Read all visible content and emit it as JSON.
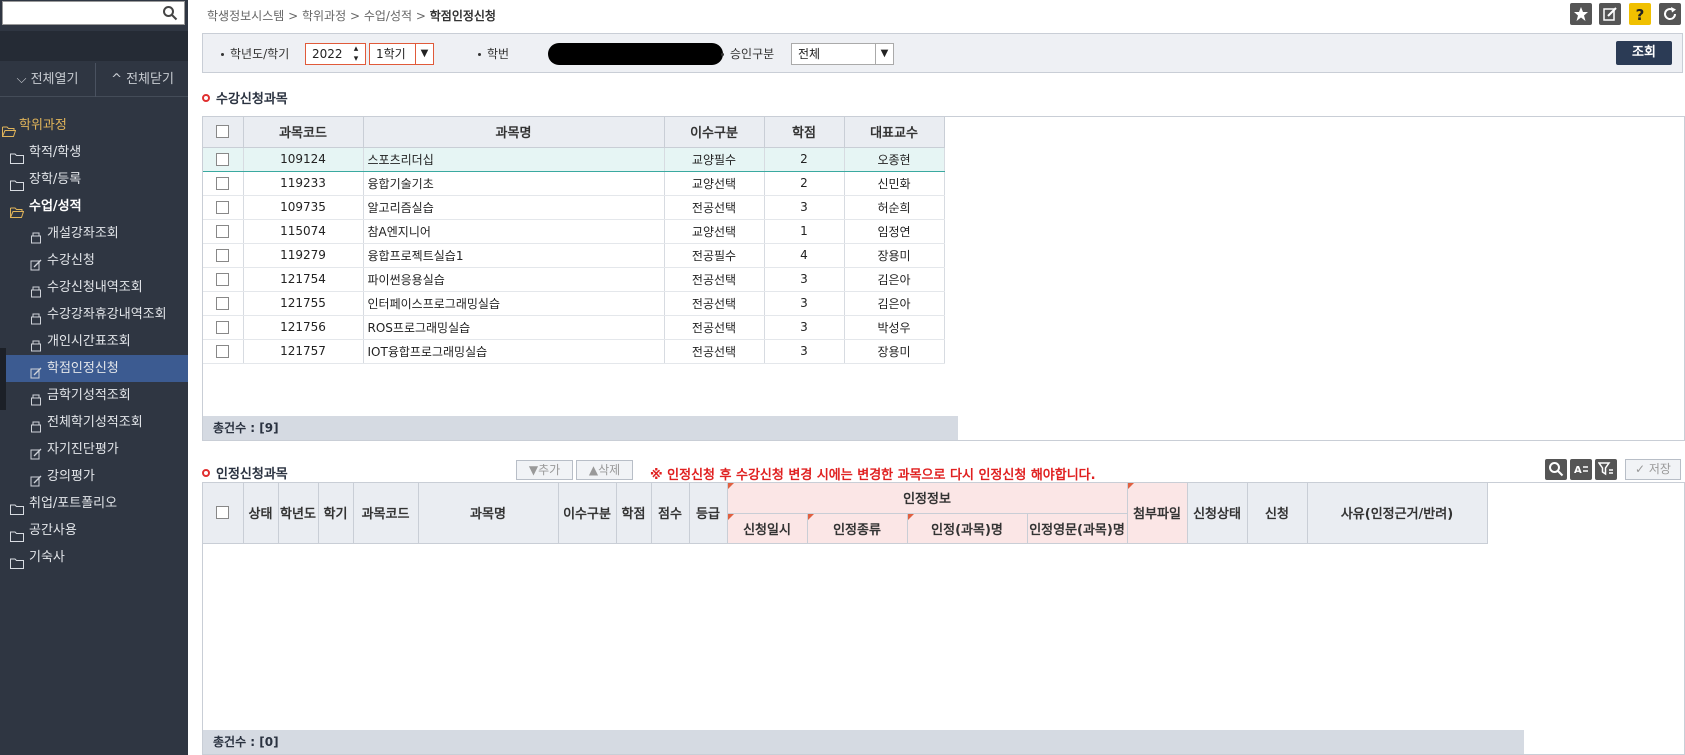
{
  "sidebar": {
    "search_placeholder": "",
    "expand_all": "전체열기",
    "collapse_all": "전체닫기",
    "tree": [
      {
        "label": "학위과정",
        "level": 0,
        "state": "open"
      },
      {
        "label": "학적/학생",
        "level": 1
      },
      {
        "label": "장학/등록",
        "level": 1
      },
      {
        "label": "수업/성적",
        "level": 1,
        "state": "open"
      },
      {
        "label": "개설강좌조회",
        "level": 2
      },
      {
        "label": "수강신청",
        "level": 2
      },
      {
        "label": "수강신청내역조회",
        "level": 2
      },
      {
        "label": "수강강좌휴강내역조회",
        "level": 2
      },
      {
        "label": "개인시간표조회",
        "level": 2
      },
      {
        "label": "학점인정신청",
        "level": 2,
        "state": "active"
      },
      {
        "label": "금학기성적조회",
        "level": 2
      },
      {
        "label": "전체학기성적조회",
        "level": 2
      },
      {
        "label": "자기진단평가",
        "level": 2
      },
      {
        "label": "강의평가",
        "level": 2
      },
      {
        "label": "취업/포트폴리오",
        "level": 1
      },
      {
        "label": "공간사용",
        "level": 1
      },
      {
        "label": "기숙사",
        "level": 1
      }
    ]
  },
  "breadcrumb": {
    "items": [
      "학생정보시스템",
      "학위과정",
      "수업/성적"
    ],
    "separator": " > ",
    "current": "학점인정신청"
  },
  "top_icons": [
    "star-icon",
    "edit-icon",
    "help-icon",
    "refresh-icon"
  ],
  "filter": {
    "year_label": "학년도/학기",
    "year_value": "2022",
    "term_value": "1학기",
    "student_id_label": "학번",
    "approval_label": "승인구분",
    "approval_value": "전체",
    "search_button": "조회"
  },
  "courses": {
    "title": "수강신청과목",
    "columns": [
      "과목코드",
      "과목명",
      "이수구분",
      "학점",
      "대표교수"
    ],
    "rows": [
      {
        "code": "109124",
        "name": "스포츠리더십",
        "type": "교양필수",
        "credit": "2",
        "prof": "오종현"
      },
      {
        "code": "119233",
        "name": "융합기술기초",
        "type": "교양선택",
        "credit": "2",
        "prof": "신민화"
      },
      {
        "code": "109735",
        "name": "알고리즘실습",
        "type": "전공선택",
        "credit": "3",
        "prof": "허순희"
      },
      {
        "code": "115074",
        "name": "참A엔지니어",
        "type": "교양선택",
        "credit": "1",
        "prof": "임정연"
      },
      {
        "code": "119279",
        "name": "융합프로젝트실습1",
        "type": "전공필수",
        "credit": "4",
        "prof": "장용미"
      },
      {
        "code": "121754",
        "name": "파이썬응용실습",
        "type": "전공선택",
        "credit": "3",
        "prof": "김은아"
      },
      {
        "code": "121755",
        "name": "인터페이스프로그래밍실습",
        "type": "전공선택",
        "credit": "3",
        "prof": "김은아"
      },
      {
        "code": "121756",
        "name": "ROS프로그래밍실습",
        "type": "전공선택",
        "credit": "3",
        "prof": "박성우"
      },
      {
        "code": "121757",
        "name": "IOT융합프로그래밍실습",
        "type": "전공선택",
        "credit": "3",
        "prof": "장용미"
      }
    ],
    "footer": "총건수 : [9]"
  },
  "recognition": {
    "title": "인정신청과목",
    "add_button": "▼추가",
    "delete_button": "▲삭제",
    "notice": "※ 인정신청 후 수강신청 변경 시에는 변경한 과목으로 다시 인정신청 해야합니다.",
    "save_button": "저장",
    "columns": [
      "상태",
      "학년도",
      "학기",
      "과목코드",
      "과목명",
      "이수구분",
      "학점",
      "점수",
      "등급"
    ],
    "group_header": "인정정보",
    "group_columns": [
      "신청일시",
      "인정종류",
      "인정(과목)명",
      "인정영문(과목)명"
    ],
    "tail_columns": [
      "첨부파일",
      "신청상태",
      "신청",
      "사유(인정근거/반려)"
    ],
    "footer": "총건수 : [0]"
  }
}
